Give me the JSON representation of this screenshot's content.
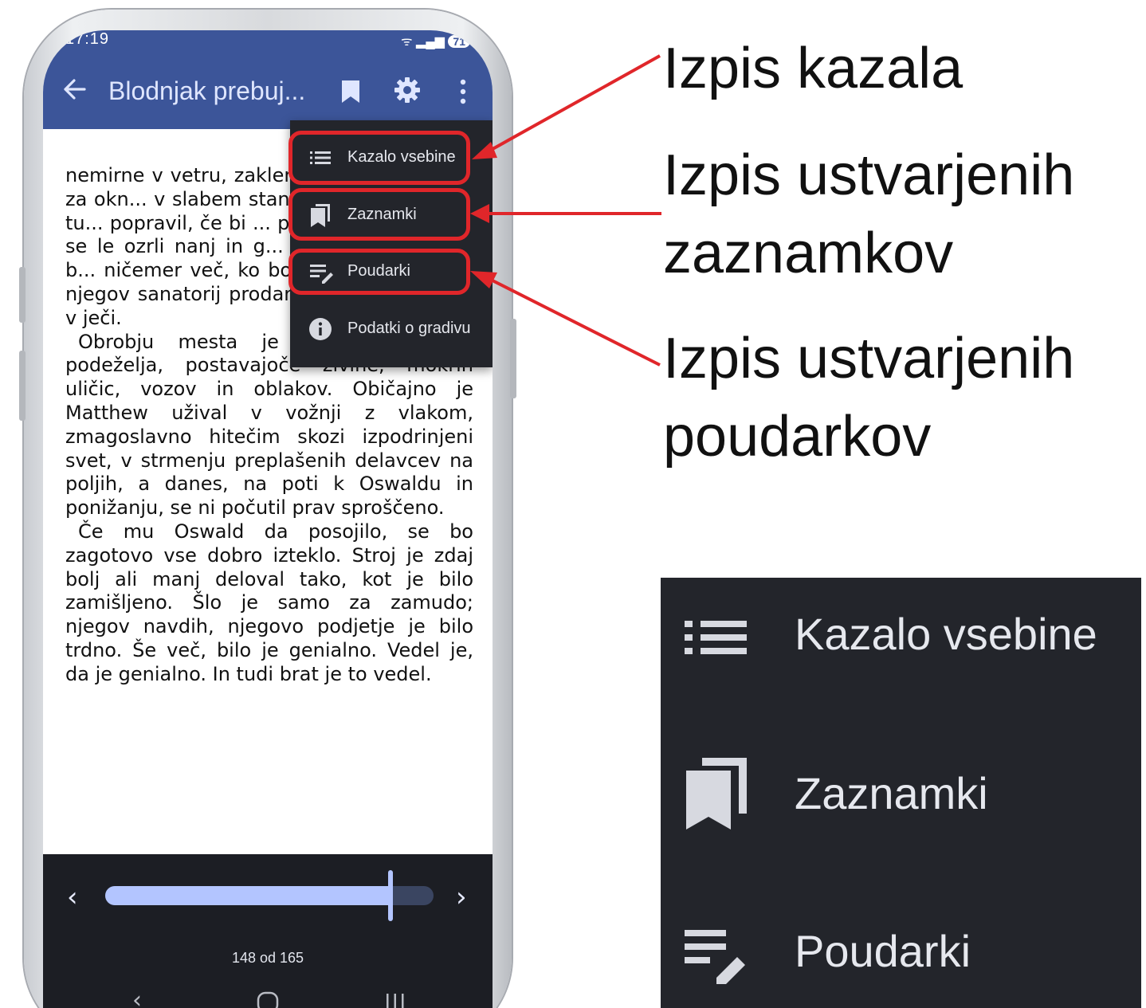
{
  "status_bar": {
    "time": "17:19",
    "battery": "71"
  },
  "app_bar": {
    "title": "Blodnjak prebuj..."
  },
  "reader": {
    "paragraphs": [
      "nemirne v vetru, zaklenjena, pospravljena za okn... v slabem stanju. D... vedel, da bi tu... popravil, če bi ... priložnost, če bi m... se le ozrli nanj in g... niso. Ljudje ga ne b... ničemer več, ko bo v bankrotu, ko bo njegov sanatorij prodan, on pa bo trohnel v ječi.",
      "Obrobju mesta je sledilo olajšanje podeželja, postavajoče živine, mokrih uličic, vozov in oblakov. Običajno je Matthew užival v vožnji z vlakom, zmagoslavno hitečim skozi izpodrinjeni svet, v strmenju preplašenih delavcev na poljih, a danes, na poti k Oswaldu in ponižanju, se ni počutil prav sproščeno.",
      "Če mu Oswald da posojilo, se bo zagotovo vse dobro izteklo. Stroj je zdaj bolj ali manj deloval tako, kot je bilo zamišljeno. Šlo je samo za zamudo; njegov navdih, njegovo podjetje je bilo trdno. Še več, bilo je genialno. Vedel je, da je genialno. In tudi brat je to vedel."
    ]
  },
  "menu": {
    "items": [
      {
        "label": "Kazalo vsebine",
        "icon": "list-icon"
      },
      {
        "label": "Zaznamki",
        "icon": "bookmarks-icon"
      },
      {
        "label": "Poudarki",
        "icon": "highlight-icon"
      },
      {
        "label": "Podatki o gradivu",
        "icon": "info-icon"
      }
    ]
  },
  "progress": {
    "page_text": "148 od 165",
    "current_page": 148,
    "total_pages": 165,
    "fraction": 0.87
  },
  "annotations": {
    "toc": "Izpis kazala",
    "bookmarks_line1": "Izpis ustvarjenih",
    "bookmarks_line2": "zaznamkov",
    "highlights_line1": "Izpis ustvarjenih",
    "highlights_line2": "poudarkov"
  },
  "zoom": {
    "items": [
      {
        "label": "Kazalo vsebine"
      },
      {
        "label": "Zaznamki"
      },
      {
        "label": "Poudarki"
      }
    ]
  },
  "colors": {
    "app_bar": "#3c5599",
    "menu_bg": "#23252b",
    "highlight_red": "#e0262a",
    "slider_fill": "#b3c5ff"
  }
}
